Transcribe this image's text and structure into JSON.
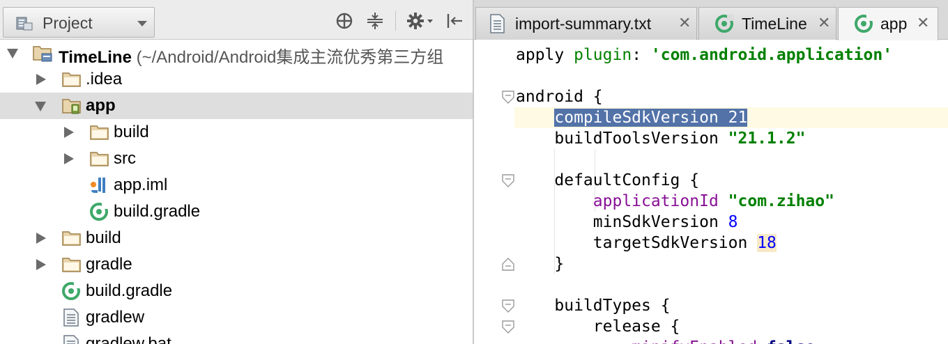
{
  "project_panel": {
    "view_selector": {
      "label": "Project",
      "icon": "project-view-icon"
    },
    "toolbar_icons": [
      "scroll-from-source-icon",
      "collapse-all-icon",
      "settings-gear-icon",
      "hide-panel-icon"
    ],
    "tree": [
      {
        "label": "TimeLine",
        "path": " (~/Android/Android集成主流优秀第三方组",
        "icon": "project-folder-icon",
        "expanded": true
      },
      {
        "label": ".idea",
        "icon": "folder-icon",
        "expanded": false
      },
      {
        "label": "app",
        "icon": "module-folder-icon",
        "expanded": true,
        "selected": true
      },
      {
        "label": "build",
        "icon": "folder-icon",
        "expanded": false
      },
      {
        "label": "src",
        "icon": "folder-icon",
        "expanded": false
      },
      {
        "label": "app.iml",
        "icon": "iml-file-icon"
      },
      {
        "label": "build.gradle",
        "icon": "gradle-file-icon"
      },
      {
        "label": "build",
        "icon": "folder-icon",
        "expanded": false
      },
      {
        "label": "gradle",
        "icon": "folder-icon",
        "expanded": false
      },
      {
        "label": "build.gradle",
        "icon": "gradle-file-icon"
      },
      {
        "label": "gradlew",
        "icon": "text-file-icon"
      },
      {
        "label": "gradlew.bat",
        "icon": "text-file-icon"
      }
    ]
  },
  "editor": {
    "tabs": [
      {
        "label": "import-summary.txt",
        "icon": "text-file-icon",
        "close": "✕"
      },
      {
        "label": "TimeLine",
        "icon": "gradle-file-icon",
        "close": "✕"
      },
      {
        "label": "app",
        "icon": "gradle-file-icon",
        "close": "✕",
        "active": true
      }
    ],
    "code": {
      "l1_a": "apply ",
      "l1_b": "plugin",
      "l1_c": ": ",
      "l1_d": "'com.android.application'",
      "l3": "android {",
      "l4_a": "compileSdkVersion ",
      "l4_b": "21",
      "l5_a": "buildToolsVersion ",
      "l5_b": "\"21.1.2\"",
      "l7": "defaultConfig {",
      "l8_a": "applicationId ",
      "l8_b": "\"com.zihao\"",
      "l9_a": "minSdkVersion ",
      "l9_b": "8",
      "l10_a": "targetSdkVersion ",
      "l10_b": "18",
      "l11": "}",
      "l13": "buildTypes {",
      "l14": "release {",
      "l15_a": "minifyEnabled ",
      "l15_b": "false"
    }
  }
}
